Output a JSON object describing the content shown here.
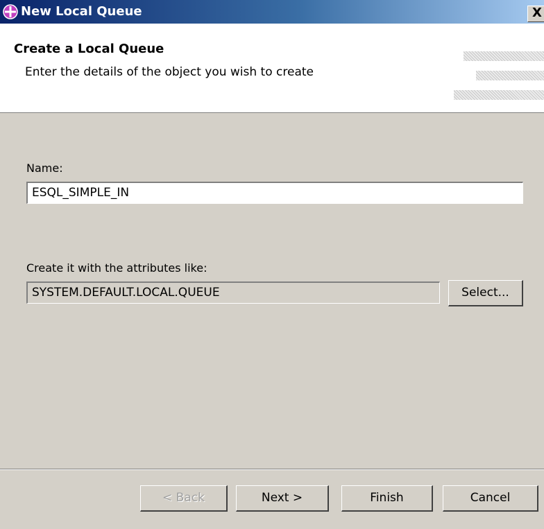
{
  "window": {
    "title": "New Local Queue",
    "close_label": "X"
  },
  "header": {
    "title": "Create a Local Queue",
    "description": "Enter the details of the object you wish to create"
  },
  "form": {
    "name_label": "Name:",
    "name_value": "ESQL_SIMPLE_IN",
    "like_label": "Create it with the attributes like:",
    "like_value": "SYSTEM.DEFAULT.LOCAL.QUEUE",
    "select_label": "Select..."
  },
  "buttons": {
    "back": "< Back",
    "next": "Next >",
    "finish": "Finish",
    "cancel": "Cancel"
  },
  "icons": {
    "app": "queue-plus-icon"
  },
  "colors": {
    "title_start": "#0a246a",
    "title_end": "#a6caf0",
    "dialog_bg": "#d4d0c8"
  }
}
